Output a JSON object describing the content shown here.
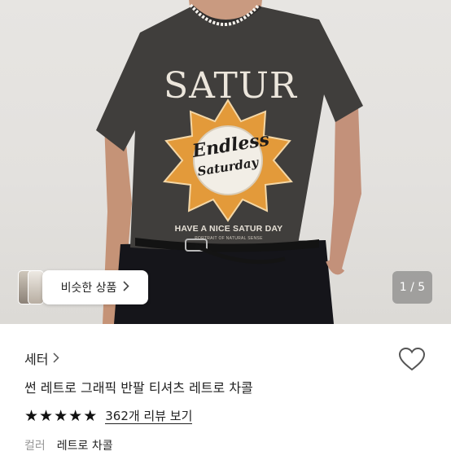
{
  "product_image": {
    "print_title": "SATUR",
    "print_line1": "Endless",
    "print_line2": "Saturday",
    "print_slogan": "HAVE A NICE SATUR DAY",
    "print_small": "PORTRAIT OF NATURAL SENSE"
  },
  "similar_products_button": {
    "label": "비슷한 상품",
    "icon": "chevron-right-icon"
  },
  "pager": {
    "text": "1 / 5"
  },
  "shop": {
    "name": "세터",
    "icon": "chevron-right-icon"
  },
  "like": {
    "icon": "heart-outline-icon"
  },
  "product": {
    "title": "썬 레트로 그래픽 반팔 티셔츠 레트로 차콜",
    "rating": 5,
    "review_link": "362개 리뷰 보기"
  },
  "option": {
    "label": "컬러",
    "value": "레트로 차콜"
  },
  "colors": {
    "shirt": "#3f3d3b",
    "sun": "#e39a3a",
    "text": "#222222"
  }
}
